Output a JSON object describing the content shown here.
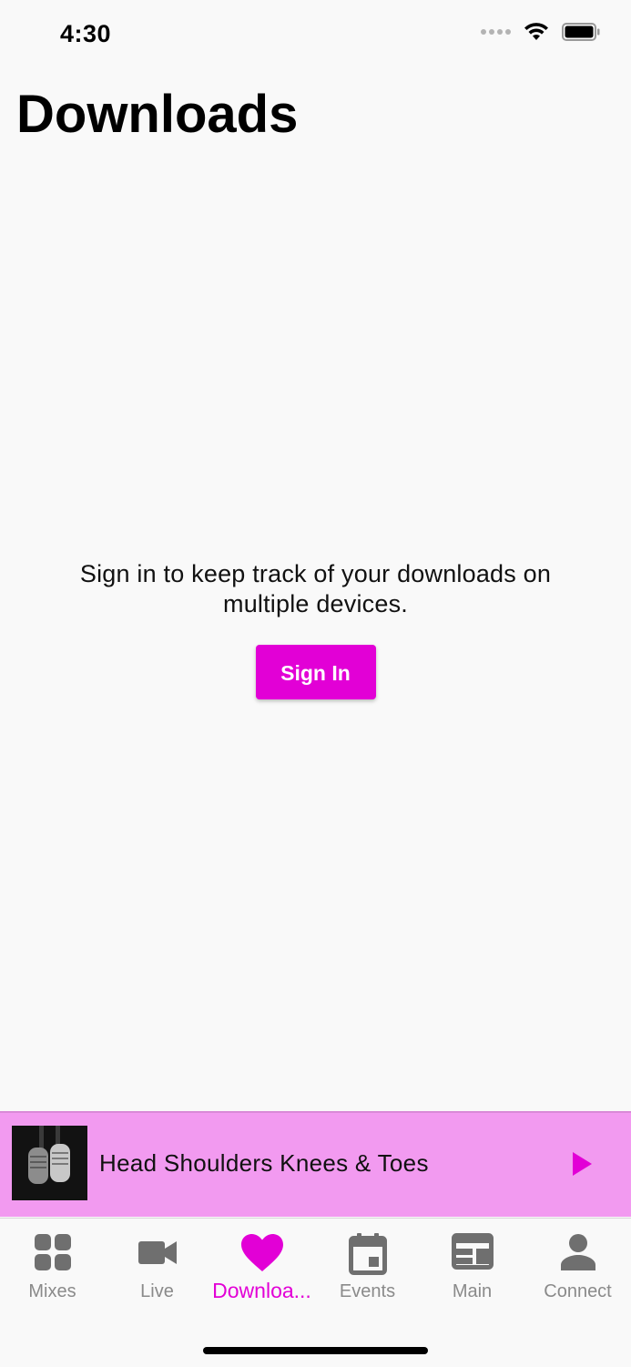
{
  "status_bar": {
    "time": "4:30"
  },
  "header": {
    "title": "Downloads"
  },
  "empty_state": {
    "message": "Sign in to keep track of your downloads on multiple devices.",
    "button_label": "Sign In"
  },
  "colors": {
    "accent": "#e200d6",
    "mini_player_bg": "#f29af0",
    "inactive": "#8a8a8a"
  },
  "mini_player": {
    "track_title": "Head Shoulders Knees & Toes",
    "play_icon": "play-icon",
    "art_icon": "album-art-microphones"
  },
  "tabs": [
    {
      "label": "Mixes",
      "icon": "grid-icon",
      "active": false
    },
    {
      "label": "Live",
      "icon": "video-camera-icon",
      "active": false
    },
    {
      "label": "Downloa...",
      "icon": "heart-icon",
      "active": true
    },
    {
      "label": "Events",
      "icon": "calendar-icon",
      "active": false
    },
    {
      "label": "Main",
      "icon": "web-layout-icon",
      "active": false
    },
    {
      "label": "Connect",
      "icon": "person-icon",
      "active": false
    }
  ]
}
